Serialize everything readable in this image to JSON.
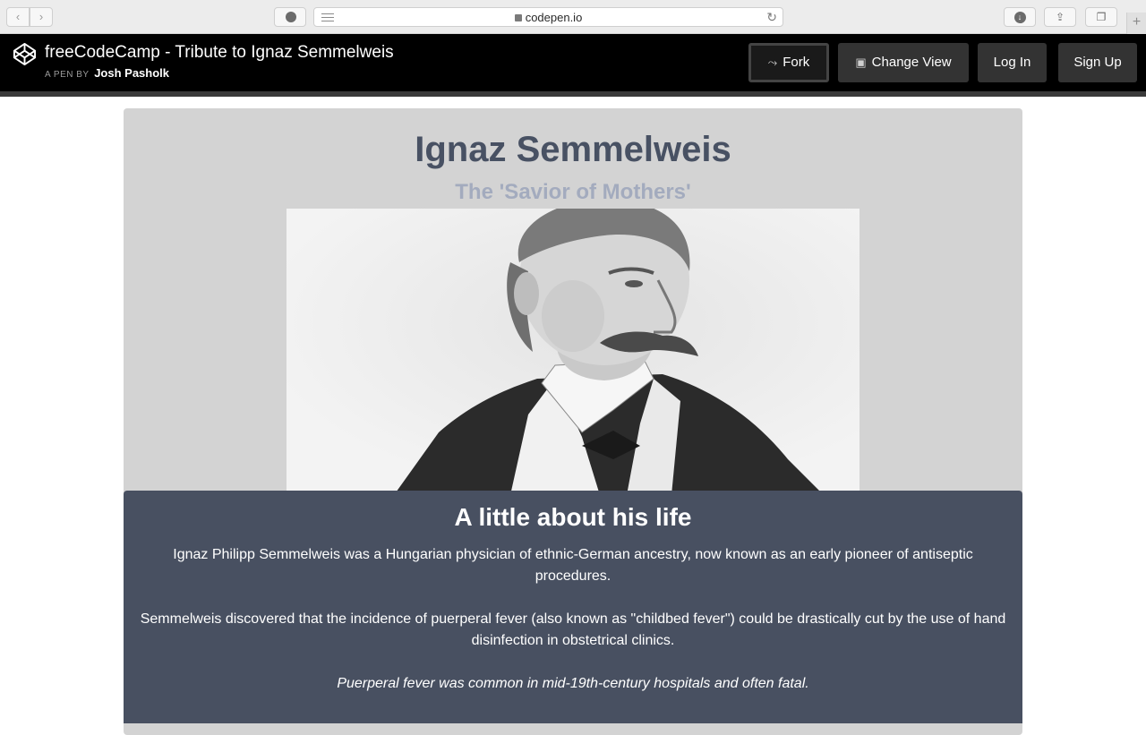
{
  "browser": {
    "url": "codepen.io"
  },
  "codepen": {
    "pen_title": "freeCodeCamp - Tribute to Ignaz Semmelweis",
    "byline_prefix": "A PEN BY",
    "author": "Josh Pasholk",
    "buttons": {
      "fork": "Fork",
      "change_view": "Change View",
      "login": "Log In",
      "signup": "Sign Up"
    }
  },
  "page": {
    "title": "Ignaz Semmelweis",
    "subtitle": "The 'Savior of Mothers'",
    "life_heading": "A little about his life",
    "paragraphs": [
      "Ignaz Philipp Semmelweis was a Hungarian physician of ethnic-German ancestry, now known as an early pioneer of antiseptic procedures.",
      "Semmelweis discovered that the incidence of puerperal fever (also known as \"childbed fever\") could be drastically cut by the use of hand disinfection in obstetrical clinics."
    ],
    "italic_note": "Puerperal fever was common in mid-19th-century hospitals and often fatal."
  }
}
